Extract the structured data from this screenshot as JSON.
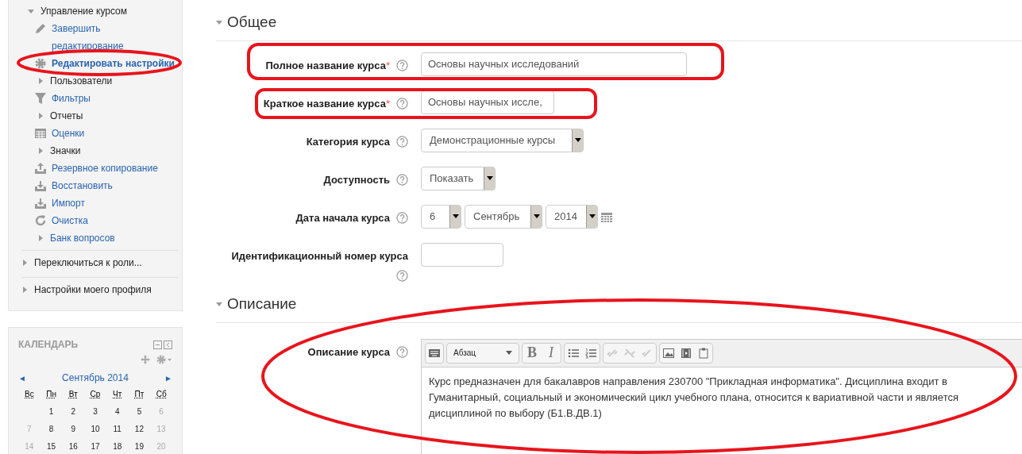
{
  "sidebar": {
    "items": [
      {
        "label": "Управление курсом",
        "expanded": true,
        "children": [
          {
            "label": "Завершить редактирование",
            "kind": "edit",
            "selected": false
          },
          {
            "label": "Редактировать настройки",
            "kind": "settings",
            "selected": true
          },
          {
            "label": "Пользователи",
            "kind": "branch",
            "expanded": false
          },
          {
            "label": "Фильтры",
            "kind": "filters",
            "selected": false
          },
          {
            "label": "Отчеты",
            "kind": "branch",
            "expanded": false
          },
          {
            "label": "Оценки",
            "kind": "grades",
            "selected": false
          },
          {
            "label": "Значки",
            "kind": "branch",
            "expanded": false
          },
          {
            "label": "Резервное копирование",
            "kind": "backup",
            "selected": false
          },
          {
            "label": "Восстановить",
            "kind": "restore",
            "selected": false
          },
          {
            "label": "Импорт",
            "kind": "import",
            "selected": false
          },
          {
            "label": "Очистка",
            "kind": "reset",
            "selected": false
          },
          {
            "label": "Банк вопросов",
            "kind": "branchlink",
            "expanded": false
          }
        ]
      }
    ],
    "sections": [
      {
        "label": "Переключиться к роли...",
        "expanded": false
      },
      {
        "label": "Настройки моего профиля",
        "expanded": false
      }
    ]
  },
  "calendar": {
    "title": "КАЛЕНДАРЬ",
    "month": "Сентябрь 2014",
    "prev": "◄",
    "next": "►",
    "weekdays": [
      "Вс",
      "Пн",
      "Вт",
      "Ср",
      "Чт",
      "Пт",
      "Сб"
    ],
    "weeks": [
      [
        "1",
        "2",
        "3",
        "4",
        "5",
        "6"
      ],
      [
        "7",
        "8",
        "9",
        "10",
        "11",
        "12",
        "13"
      ],
      [
        "14",
        "15",
        "16",
        "17",
        "18",
        "19",
        "20"
      ]
    ]
  },
  "general": {
    "title": "Общее",
    "expanded": true,
    "fields": [
      {
        "label": "Полное название курса",
        "required_mark": "*",
        "kind": "text",
        "value": "Основы научных исследований"
      },
      {
        "label": "Краткое название курса",
        "required_mark": "*",
        "kind": "text",
        "value": "Основы научных иссле,"
      },
      {
        "label": "Категория курса",
        "kind": "select",
        "value": "Демонстрационные курсы"
      },
      {
        "label": "Доступность",
        "kind": "select",
        "value": "Показать"
      },
      {
        "label": "Дата начала курса",
        "kind": "date",
        "day": "6",
        "month": "Сентябрь",
        "year": "2014"
      },
      {
        "label": "Идентификационный номер курса",
        "kind": "text"
      }
    ]
  },
  "description": {
    "title": "Описание",
    "expanded": true,
    "label": "Описание курса",
    "format": "Абзац",
    "bold": "B",
    "italic": "I",
    "text": "Курс предназначен для бакалавров направления 230700 \"Прикладная информатика\". Дисциплина входит в Гуманитарный, социальный и экономический цикл учебного плана, относится к вариативной части и является дисциплиной по выбору (Б1.В.ДВ.1)"
  }
}
